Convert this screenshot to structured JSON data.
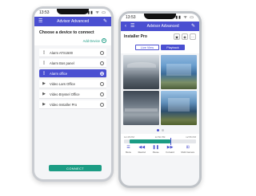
{
  "phone1": {
    "status": {
      "time": "13:53",
      "indicators": "▮▮ ᯤ ▭"
    },
    "appbar": {
      "title": "Advisor Advanced",
      "menu_icon": "menu-icon",
      "edit_icon": "edit-icon"
    },
    "heading": "Choose a device to connect",
    "add_device_label": "Add Device",
    "devices": [
      {
        "name": "Alarm ATS1500",
        "icon": "panel-icon",
        "selected": false
      },
      {
        "name": "Alarm Bos panel",
        "icon": "panel-icon",
        "selected": false
      },
      {
        "name": "Alarm office",
        "icon": "panel-icon",
        "selected": true
      },
      {
        "name": "Video Lars Office",
        "icon": "camera-icon",
        "selected": false
      },
      {
        "name": "Video Bryssel Office",
        "icon": "camera-icon",
        "selected": false
      },
      {
        "name": "Video Installer Pro",
        "icon": "camera-icon",
        "selected": false
      }
    ],
    "connect_label": "CONNECT"
  },
  "phone2": {
    "status": {
      "time": "13:53",
      "indicators": "▮▮ ᯤ ▭"
    },
    "appbar": {
      "title": "Advisor Advanced"
    },
    "installer_title": "Installer Pro",
    "tabs": [
      {
        "label": "Live View",
        "active": false
      },
      {
        "label": "Playback",
        "active": true
      }
    ],
    "timeline": {
      "times": [
        "12:45 PM",
        "12:50 PM",
        "12:55 PM"
      ],
      "progress": 0.64
    },
    "controls": [
      {
        "label": "Menu",
        "icon": "menu-icon"
      },
      {
        "label": "Rewind",
        "icon": "rewind-icon"
      },
      {
        "label": "Pause",
        "icon": "pause-icon"
      },
      {
        "label": "Forward",
        "icon": "forward-icon"
      },
      {
        "label": "Multi Camera",
        "icon": "grid-icon"
      }
    ]
  },
  "colors": {
    "accent": "#4a4fd1",
    "connect": "#1c9c84"
  }
}
